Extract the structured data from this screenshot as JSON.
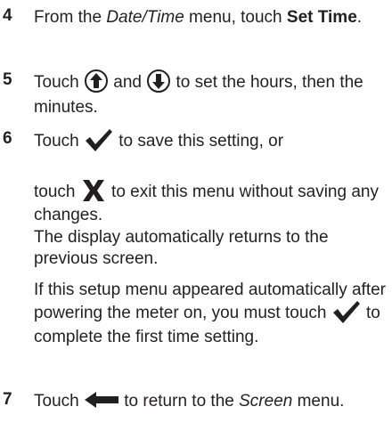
{
  "steps": [
    {
      "number": "4",
      "text_before": "From the ",
      "menu_name": "Date/Time",
      "text_middle": " menu, touch ",
      "button_name": "Set Time",
      "text_after": "."
    },
    {
      "number": "5",
      "text_a": "Touch ",
      "text_b": " and ",
      "text_c": " to set the hours, then the minutes.",
      "icons": [
        "up-arrow-icon",
        "down-arrow-icon"
      ]
    },
    {
      "number": "6",
      "line1_a": "Touch ",
      "line1_b": " to save this setting, or",
      "line2_a": "touch ",
      "line2_b": " to exit this menu without saving any changes.",
      "line3": "The display automatically returns to the previous screen.",
      "note_a": "If this setup menu appeared automatically after powering the meter on, you must touch ",
      "note_b": " to complete the first time setting.",
      "icons": [
        "checkmark-icon",
        "x-icon"
      ]
    },
    {
      "number": "7",
      "text_a": "Touch ",
      "text_b": " to return to the ",
      "menu_name": "Screen",
      "text_c": " menu.",
      "icons": [
        "back-arrow-icon"
      ]
    }
  ],
  "colors": {
    "text": "#231f20"
  }
}
